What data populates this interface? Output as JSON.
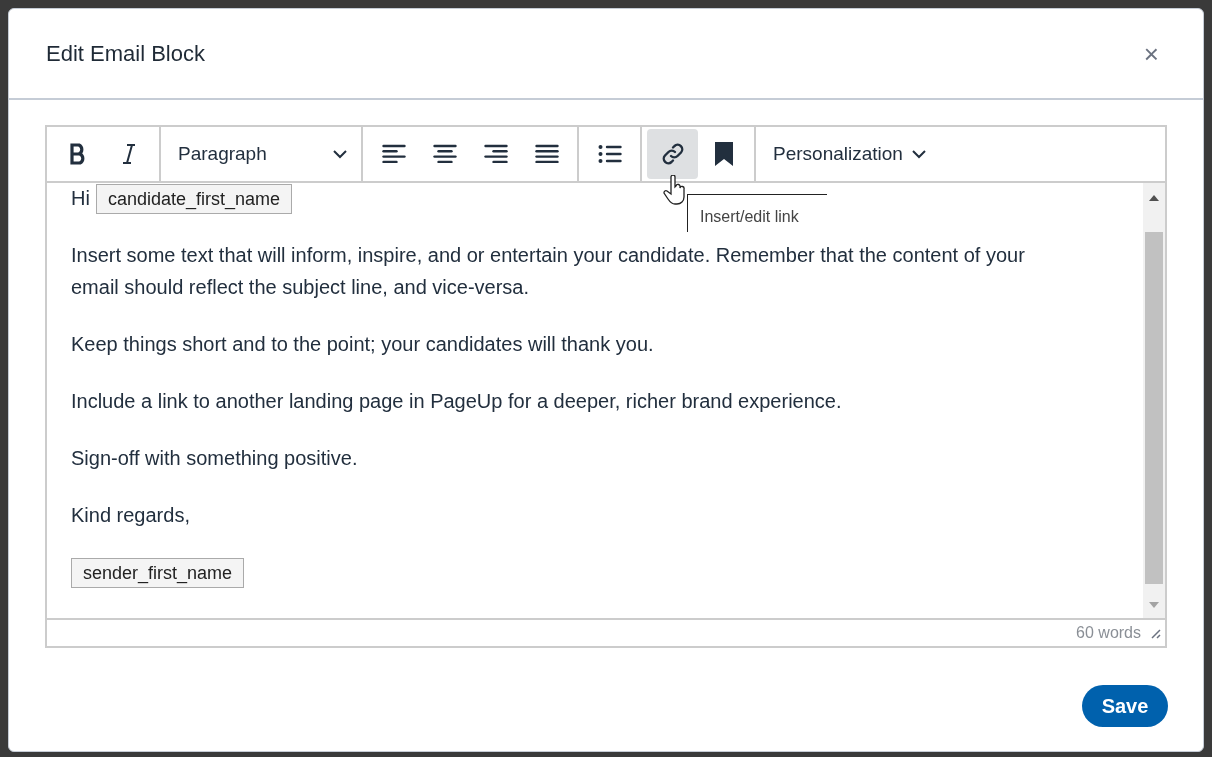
{
  "dialog": {
    "title": "Edit Email Block",
    "close": "×"
  },
  "toolbar": {
    "groups": [
      [
        {
          "kind": "bold",
          "active": false
        },
        {
          "kind": "italic",
          "active": false
        }
      ],
      [
        {
          "kind": "dropdown",
          "label": "Paragraph"
        }
      ],
      [
        {
          "kind": "align-left",
          "active": false
        },
        {
          "kind": "align-center",
          "active": false
        },
        {
          "kind": "align-right",
          "active": false
        },
        {
          "kind": "align-justify",
          "active": false
        }
      ],
      [
        {
          "kind": "bullet-list",
          "active": false
        }
      ],
      [
        {
          "kind": "link",
          "active": true
        },
        {
          "kind": "bookmark",
          "active": false
        }
      ],
      [
        {
          "kind": "menu",
          "label": "Personalization"
        }
      ]
    ]
  },
  "tooltip": "Insert/edit link",
  "editor": {
    "paragraphs": [
      [
        {
          "kind": "text",
          "text": "Hi"
        },
        {
          "kind": "token",
          "text": "candidate_first_name"
        }
      ],
      [
        {
          "kind": "text",
          "text": "Insert some text that will inform, inspire, and or entertain your candidate. Remember that the content of your email should reflect the subject line, and vice-versa."
        }
      ],
      [
        {
          "kind": "text",
          "text": "Keep things short and to the point; your candidates will thank you."
        }
      ],
      [
        {
          "kind": "text",
          "text": "Include a link to another landing page in PageUp for a deeper, richer brand experience."
        }
      ],
      [
        {
          "kind": "text",
          "text": "Sign-off with something positive."
        }
      ],
      [
        {
          "kind": "text",
          "text": "Kind regards,"
        }
      ],
      [
        {
          "kind": "token",
          "text": "sender_first_name"
        }
      ]
    ],
    "word_count": "60 words"
  },
  "buttons": [
    {
      "label": "Save"
    }
  ]
}
